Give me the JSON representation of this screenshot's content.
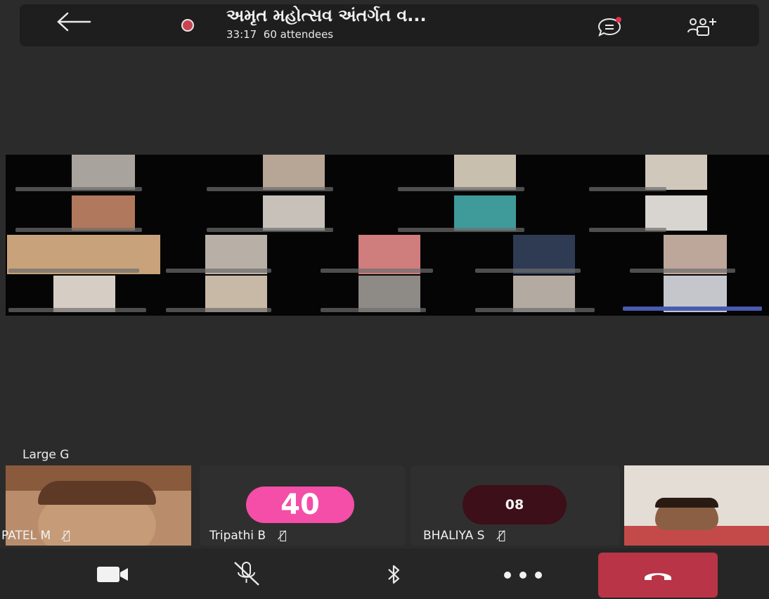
{
  "header": {
    "title": "અમૃત મહોત્સવ અંતર્ગત વ...",
    "timer": "33:17",
    "attendees": "60 attendees",
    "recording_color": "#c9434f",
    "chat_badge_color": "#e0304a"
  },
  "gallery_label": "Large G",
  "strip": [
    {
      "name": "PATEL M",
      "mic": "mic-off-icon"
    },
    {
      "name": "Tripathi B",
      "avatar_text": "40",
      "avatar_color": "#f44ea8",
      "mic": "mic-off-icon"
    },
    {
      "name": "BHALIYA S",
      "avatar_text": "08",
      "avatar_color": "#3d0f18",
      "mic": "mic-off-icon"
    },
    {
      "name": "",
      "mic": ""
    }
  ],
  "controls": {
    "camera": "video-camera-icon",
    "mic": "mic-off-icon",
    "bluetooth": "bluetooth-icon",
    "more": "more-icon",
    "leave": "hang-up-icon",
    "leave_color": "#b93447"
  }
}
